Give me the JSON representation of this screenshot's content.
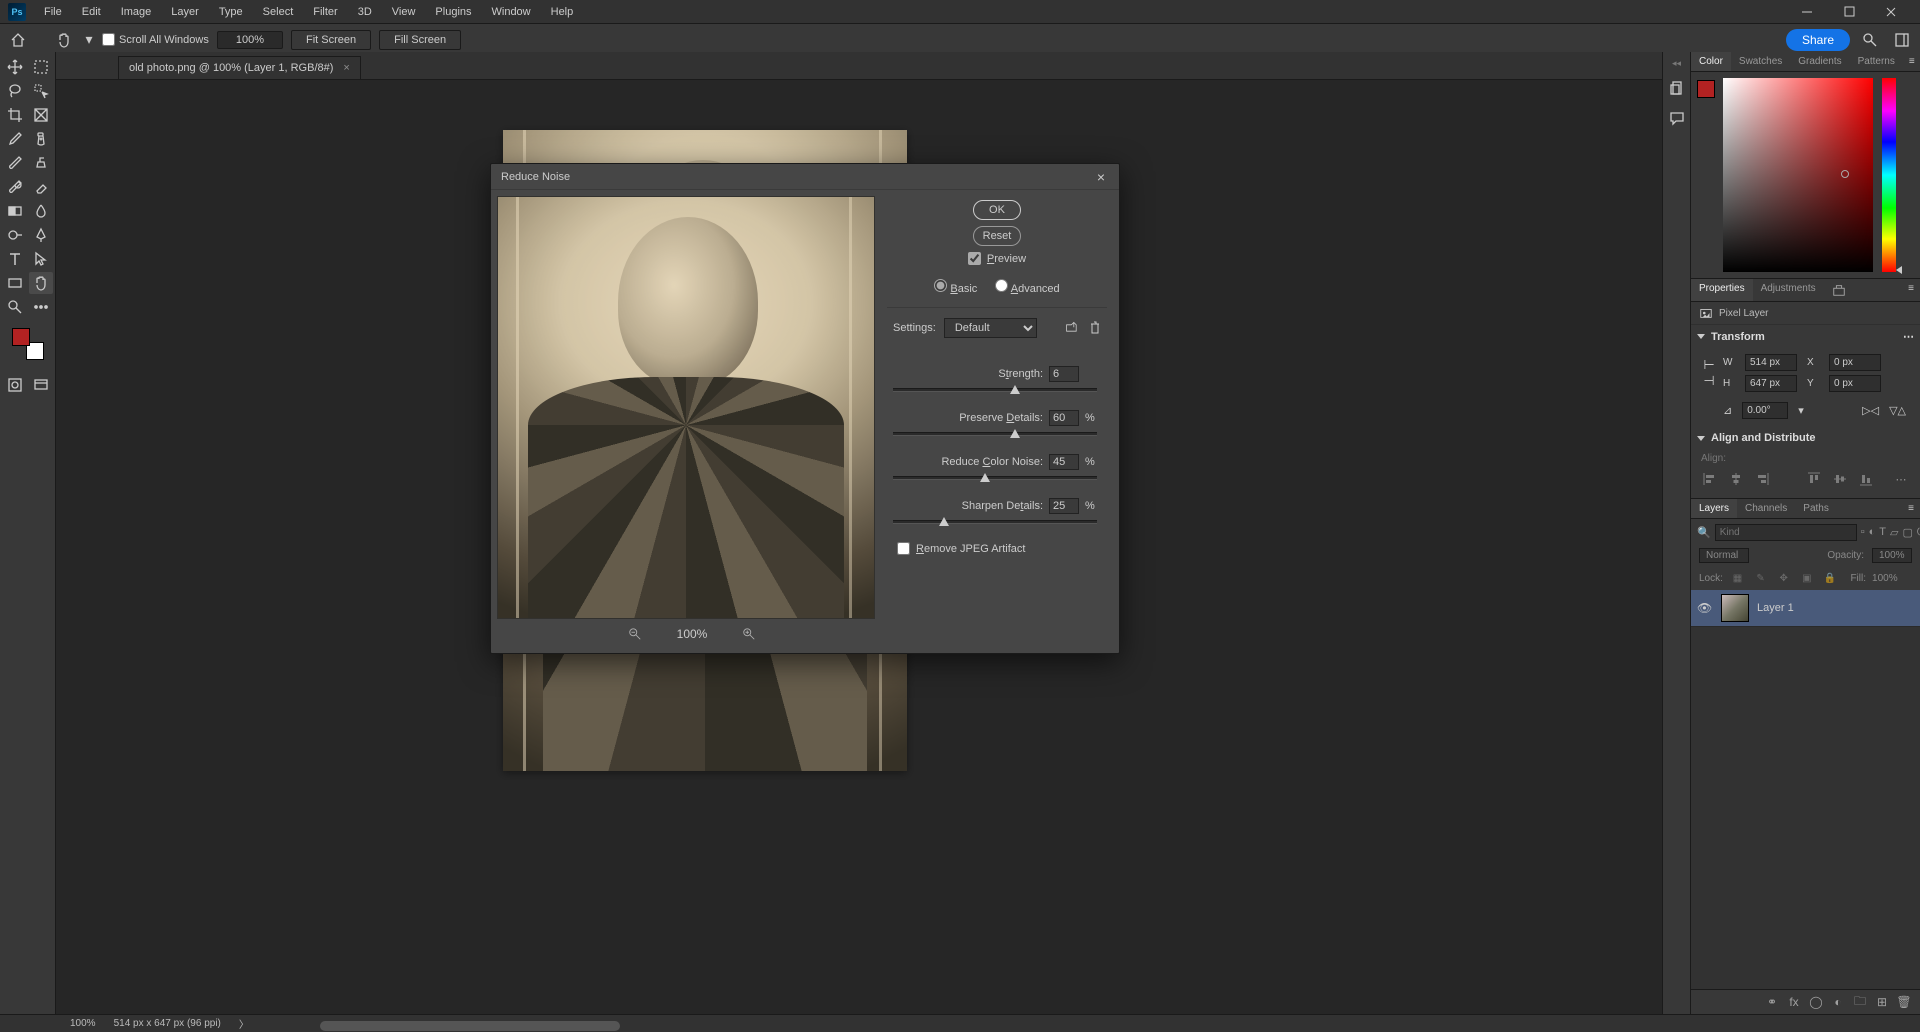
{
  "menu": {
    "items": [
      "File",
      "Edit",
      "Image",
      "Layer",
      "Type",
      "Select",
      "Filter",
      "3D",
      "View",
      "Plugins",
      "Window",
      "Help"
    ]
  },
  "options": {
    "scroll_all": "Scroll All Windows",
    "zoom": "100%",
    "fit": "Fit Screen",
    "fill": "Fill Screen",
    "share": "Share"
  },
  "tab": {
    "title": "old photo.png @ 100% (Layer 1, RGB/8#)"
  },
  "dialog": {
    "title": "Reduce Noise",
    "ok": "OK",
    "reset": "Reset",
    "preview": "Preview",
    "basic": "Basic",
    "advanced": "Advanced",
    "settings_label": "Settings:",
    "settings_value": "Default",
    "sliders": {
      "strength": {
        "label": "Strength:",
        "value": "6",
        "pct": "",
        "pos": 60
      },
      "preserve": {
        "label": "Preserve Details:",
        "value": "60",
        "pct": "%",
        "pos": 60
      },
      "color_noise": {
        "label": "Reduce Color Noise:",
        "value": "45",
        "pct": "%",
        "pos": 45
      },
      "sharpen": {
        "label": "Sharpen Details:",
        "value": "25",
        "pct": "%",
        "pos": 25
      }
    },
    "remove_jpeg": "Remove JPEG Artifact",
    "zoom_label": "100%"
  },
  "color_panel": {
    "tabs": [
      "Color",
      "Swatches",
      "Gradients",
      "Patterns"
    ]
  },
  "properties_panel": {
    "tabs": [
      "Properties",
      "Adjustments"
    ],
    "kind": "Pixel Layer",
    "transform": "Transform",
    "W": "514 px",
    "H": "647 px",
    "X": "0 px",
    "Y": "0 px",
    "angle": "0.00°",
    "align_title": "Align and Distribute",
    "align_label": "Align:"
  },
  "layers_panel": {
    "tabs": [
      "Layers",
      "Channels",
      "Paths"
    ],
    "kind_placeholder": "Kind",
    "blend": "Normal",
    "opacity_label": "Opacity:",
    "opacity_val": "100%",
    "lock_label": "Lock:",
    "fill_label": "Fill:",
    "fill_val": "100%",
    "layer_name": "Layer 1"
  },
  "status": {
    "zoom": "100%",
    "dims": "514 px x 647 px (96 ppi)"
  }
}
